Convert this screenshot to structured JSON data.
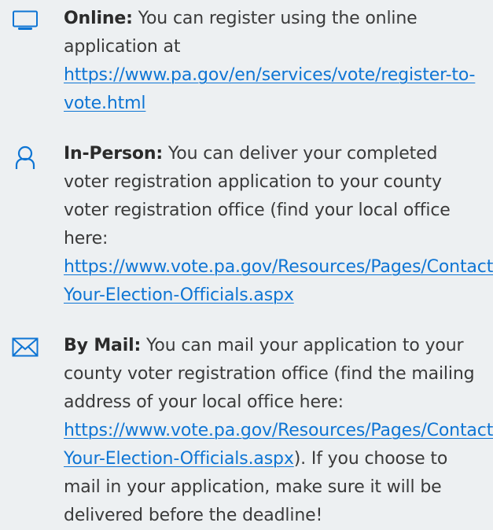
{
  "items": [
    {
      "label": "Online:",
      "text": " You can register using the online application at ",
      "link": "https://www.pa.gov/en/services/vote/register-to-vote.html",
      "after": "",
      "icon": "monitor-icon"
    },
    {
      "label": "In-Person:",
      "text": " You can deliver your completed voter registration application to your county voter registration office (find your local office here: ",
      "link": "https://www.vote.pa.gov/Resources/Pages/Contact-Your-Election-Officials.aspx",
      "after": "",
      "icon": "person-icon"
    },
    {
      "label": "By Mail:",
      "text": " You can mail your application to your county voter registration office (find the mailing address of your local office here: ",
      "link": "https://www.vote.pa.gov/Resources/Pages/Contact-Your-Election-Officials.aspx",
      "after": "). If you choose to mail in your application, make sure it will be delivered before the deadline!",
      "icon": "envelope-icon"
    }
  ],
  "colors": {
    "background": "#edf0f2",
    "accent": "#0e75d4",
    "text": "#3a3a3a"
  }
}
